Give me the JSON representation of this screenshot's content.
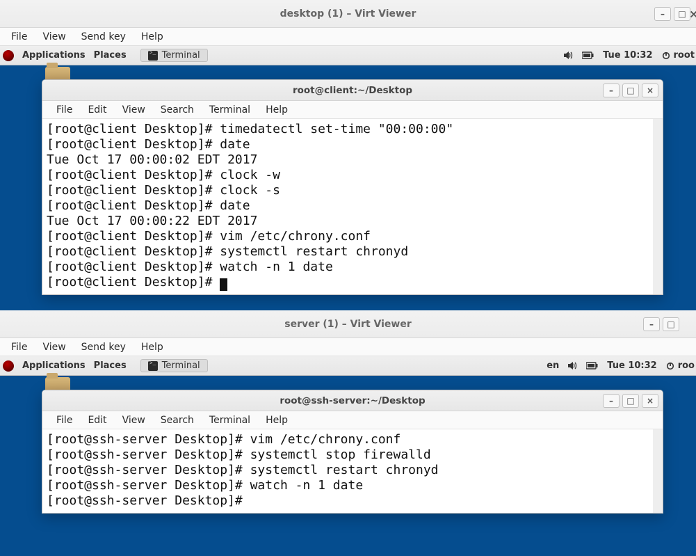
{
  "vv": {
    "titles": [
      "desktop (1) – Virt Viewer",
      "server (1) – Virt Viewer"
    ],
    "menu": [
      "File",
      "View",
      "Send key",
      "Help"
    ]
  },
  "gnome": {
    "applications": "Applications",
    "places": "Places",
    "task_terminal": "Terminal",
    "lang": "en",
    "clock": "Tue 10:32",
    "user1": "root",
    "user2": "roo"
  },
  "term_menus": [
    "File",
    "Edit",
    "View",
    "Search",
    "Terminal",
    "Help"
  ],
  "terminal1": {
    "title": "root@client:~/Desktop",
    "lines": [
      "[root@client Desktop]# timedatectl set-time \"00:00:00\"",
      "[root@client Desktop]# date",
      "Tue Oct 17 00:00:02 EDT 2017",
      "[root@client Desktop]# clock -w",
      "[root@client Desktop]# clock -s",
      "[root@client Desktop]# date",
      "Tue Oct 17 00:00:22 EDT 2017",
      "[root@client Desktop]# vim /etc/chrony.conf",
      "[root@client Desktop]# systemctl restart chronyd",
      "[root@client Desktop]# watch -n 1 date",
      "[root@client Desktop]# "
    ]
  },
  "terminal2": {
    "title": "root@ssh-server:~/Desktop",
    "lines": [
      "[root@ssh-server Desktop]# vim /etc/chrony.conf",
      "[root@ssh-server Desktop]# systemctl stop firewalld",
      "[root@ssh-server Desktop]# systemctl restart chronyd",
      "[root@ssh-server Desktop]# watch -n 1 date",
      "[root@ssh-server Desktop]# "
    ]
  }
}
